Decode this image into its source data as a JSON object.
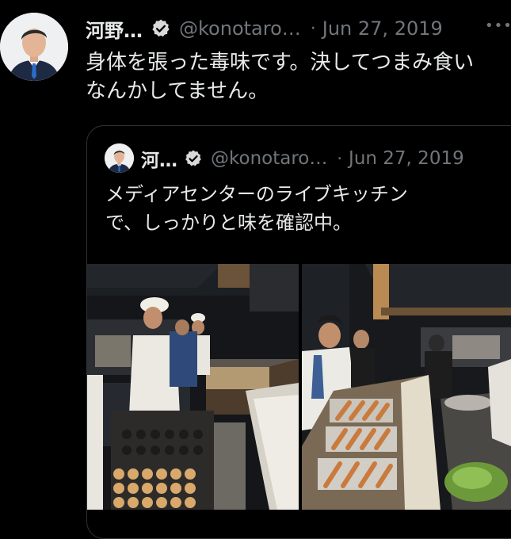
{
  "tweet": {
    "display_name": "河野…",
    "handle": "@konotaro…",
    "separator": "·",
    "date": "Jun 27, 2019",
    "more": "•••",
    "text_line1": "身体を張った毒味です。決してつまみ食い",
    "text_line2": "なんかしてません。"
  },
  "quoted": {
    "display_name": "河…",
    "handle": "@konotaro…",
    "separator": "·",
    "date": "Jun 27, 2019",
    "text_line1": "メディアセンターのライブキッチン",
    "text_line2": "で、しっかりと味を確認中。"
  },
  "colors": {
    "background": "#000000",
    "text": "#e7e9ea",
    "secondary_text": "#71767b",
    "border": "#2f3336"
  }
}
